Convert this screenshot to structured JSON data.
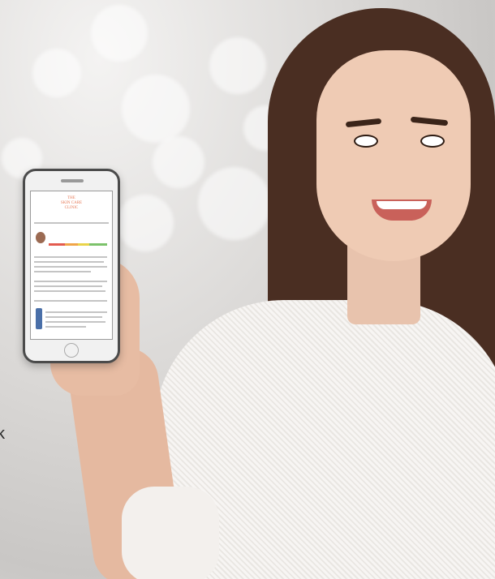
{
  "edge_fragment": "k",
  "phone_screen": {
    "logo_line1": "THE",
    "logo_line2": "SKIN CARE",
    "logo_line3": "CLINIC"
  },
  "colors": {
    "logo_accent": "#e77a58",
    "bar_red": "#e35b4f",
    "bar_orange": "#f0a548",
    "bar_yellow": "#e9d34a",
    "bar_green": "#7cc26b"
  }
}
